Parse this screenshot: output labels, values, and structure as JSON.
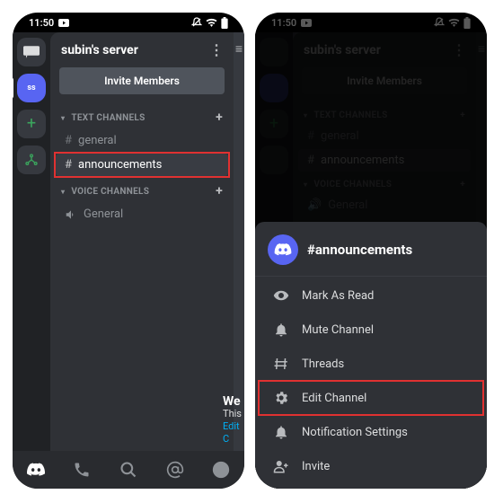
{
  "statusbar": {
    "time": "11:50"
  },
  "server": {
    "name": "subin's server",
    "initials": "ss",
    "invite_label": "Invite Members"
  },
  "categories": {
    "text": {
      "label": "TEXT CHANNELS"
    },
    "voice": {
      "label": "VOICE CHANNELS"
    }
  },
  "channels": {
    "general_text": "general",
    "announcements": "announcements",
    "general_voice": "General"
  },
  "welcome": {
    "title_clip": "We",
    "sub_clip": "This",
    "link_clip": "Edit C"
  },
  "sheet": {
    "channel_title": "#announcements",
    "items": {
      "mark_read": "Mark As Read",
      "mute": "Mute Channel",
      "threads": "Threads",
      "edit": "Edit Channel",
      "notifications": "Notification Settings",
      "invite": "Invite"
    }
  },
  "colors": {
    "blurple": "#5865f2",
    "highlight": "#e03131",
    "bg_dark": "#2f3136"
  },
  "chart_data": null
}
